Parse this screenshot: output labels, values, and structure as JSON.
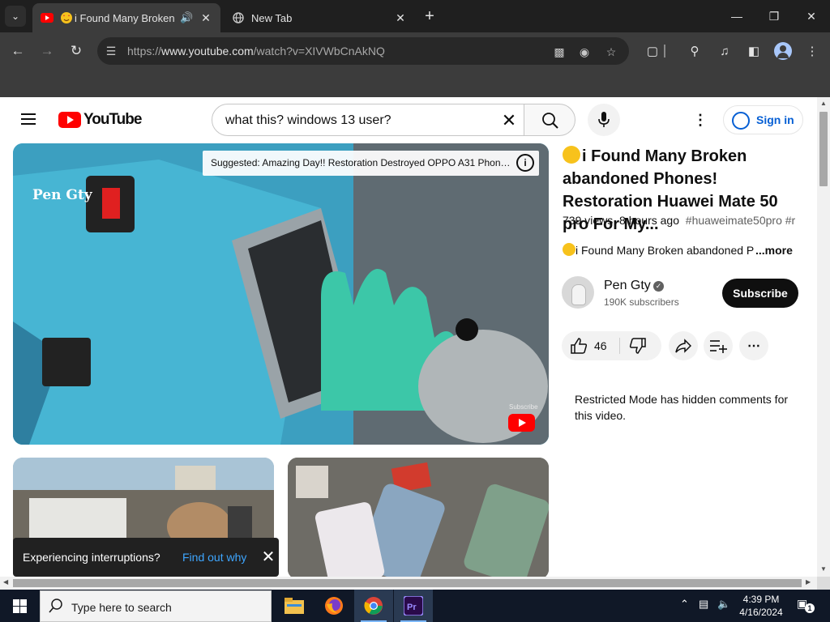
{
  "browser": {
    "tabs": [
      {
        "title": "i Found Many Broken abandoned Phones! Restoration Huawei Mate 50 pro For My...",
        "favicon": "youtube-icon",
        "audio": "speaker-icon"
      },
      {
        "title": "New Tab",
        "favicon": "globe-icon"
      }
    ],
    "url_scheme": "https://",
    "url_host": "www.youtube.com",
    "url_path": "/watch?v=XIVWbCnAkNQ",
    "icons": {
      "tab_menu": "chevron-down-icon",
      "new_tab": "plus-icon",
      "minimize": "minimize-icon",
      "maximize": "restore-icon",
      "close": "close-icon",
      "back": "back-arrow-icon",
      "forward": "forward-arrow-icon",
      "reload": "reload-icon"
    }
  },
  "youtube": {
    "logo_text": "YouTube",
    "search_query": "what this? windows 13 user?",
    "signin_label": "Sign in",
    "video": {
      "suggested_text": "Suggested: Amazing Day!! Restoration Destroyed OPPO A31 Phone...",
      "watermark": "Pen Gty",
      "subscribe_watermark": "Subscribe",
      "title": "i Found Many Broken abandoned Phones! Restoration Huawei Mate 50 pro For My...",
      "views": "739 views",
      "age": "8 hours ago",
      "hashtags": "#huaweimate50pro #r",
      "description_snippet": "i Found Many Broken abandoned P",
      "more_label": "...more"
    },
    "channel": {
      "name": "Pen Gty",
      "subscribers": "190K subscribers",
      "subscribe_label": "Subscribe"
    },
    "actions": {
      "like_count": "46"
    },
    "comments_notice": "Restricted Mode has hidden comments for this video.",
    "toast": {
      "message": "Experiencing interruptions?",
      "link": "Find out why"
    }
  },
  "taskbar": {
    "search_placeholder": "Type here to search",
    "time": "4:39 PM",
    "date": "4/16/2024",
    "notification_count": "1",
    "accent": "#7cb8ff"
  },
  "colors": {
    "youtube_red": "#ff0000",
    "link_blue": "#065fd4",
    "chrome_dark": "#1f1f1f",
    "toolbar": "#3c3c3c"
  }
}
